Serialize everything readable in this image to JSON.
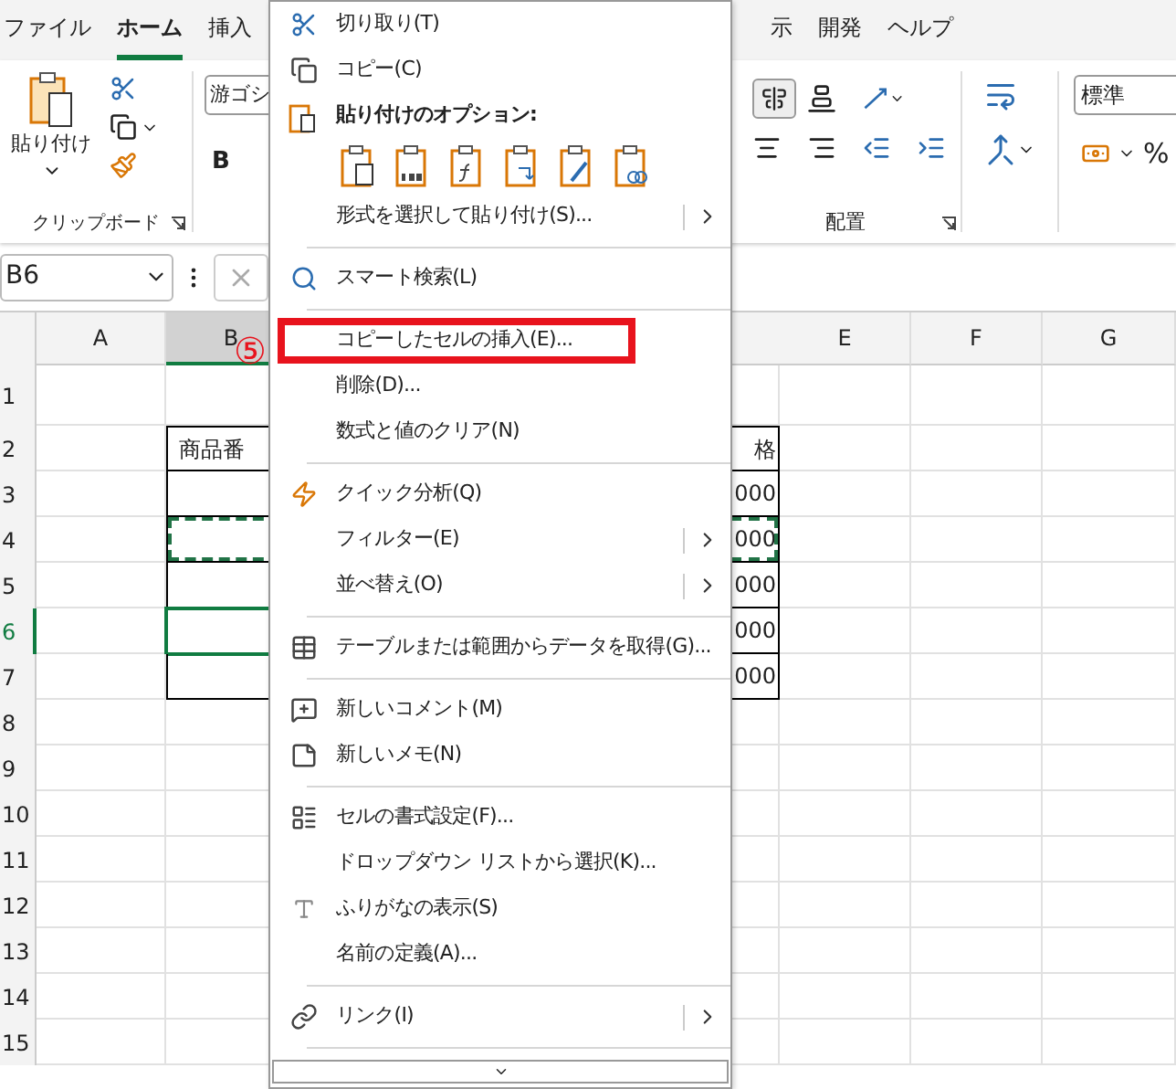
{
  "ribbon_tabs": [
    {
      "label": "ファイル",
      "selected": false
    },
    {
      "label": "ホーム",
      "selected": true
    },
    {
      "label": "挿入",
      "selected": false
    },
    {
      "label": "示",
      "selected": false
    },
    {
      "label": "開発",
      "selected": false
    },
    {
      "label": "ヘルプ",
      "selected": false
    }
  ],
  "clipboard_group": {
    "paste_label": "貼り付け",
    "group_label": "クリップボード"
  },
  "font_group": {
    "font_name": "游ゴシ",
    "bold_label": "B"
  },
  "alignment_group": {
    "group_label": "配置"
  },
  "number_group": {
    "format": "標準",
    "percent_label": "%"
  },
  "formula_bar": {
    "name_box": "B6"
  },
  "columns": [
    {
      "label": "A",
      "selected": false
    },
    {
      "label": "B",
      "selected": true
    },
    {
      "label": "E",
      "selected": false
    },
    {
      "label": "F",
      "selected": false
    },
    {
      "label": "G",
      "selected": false
    }
  ],
  "rows": [
    {
      "label": "1",
      "selected": false,
      "copied": false
    },
    {
      "label": "2",
      "selected": false,
      "copied": false,
      "column_b": "商品番",
      "column_d": "格"
    },
    {
      "label": "3",
      "selected": false,
      "copied": false,
      "column_d": "000"
    },
    {
      "label": "4",
      "selected": false,
      "copied": true,
      "column_d": "000"
    },
    {
      "label": "5",
      "selected": false,
      "copied": false,
      "column_d": "000"
    },
    {
      "label": "6",
      "selected": true,
      "copied": false,
      "column_d": "000"
    },
    {
      "label": "7",
      "selected": false,
      "copied": false,
      "column_d": "000"
    },
    {
      "label": "8",
      "selected": false,
      "copied": false
    },
    {
      "label": "9",
      "selected": false,
      "copied": false
    },
    {
      "label": "10",
      "selected": false,
      "copied": false
    },
    {
      "label": "11",
      "selected": false,
      "copied": false
    },
    {
      "label": "12",
      "selected": false,
      "copied": false
    },
    {
      "label": "13",
      "selected": false,
      "copied": false
    },
    {
      "label": "14",
      "selected": false,
      "copied": false
    },
    {
      "label": "15",
      "selected": false,
      "copied": false
    }
  ],
  "context_menu": {
    "step_marker": "⑤",
    "items": [
      {
        "kind": "item",
        "label": "切り取り(T)",
        "submenu": false,
        "highlighted": false
      },
      {
        "kind": "item",
        "label": "コピー(C)",
        "submenu": false,
        "highlighted": false
      },
      {
        "kind": "header",
        "label": "貼り付けのオプション:"
      },
      {
        "kind": "paste_icons"
      },
      {
        "kind": "item",
        "label": "形式を選択して貼り付け(S)...",
        "submenu": true,
        "highlighted": false
      },
      {
        "kind": "separator"
      },
      {
        "kind": "item",
        "label": "スマート検索(L)",
        "submenu": false,
        "highlighted": false
      },
      {
        "kind": "separator"
      },
      {
        "kind": "item",
        "label": "コピーしたセルの挿入(E)...",
        "submenu": false,
        "highlighted": true
      },
      {
        "kind": "item",
        "label": "削除(D)...",
        "submenu": false,
        "highlighted": false
      },
      {
        "kind": "item",
        "label": "数式と値のクリア(N)",
        "submenu": false,
        "highlighted": false
      },
      {
        "kind": "separator"
      },
      {
        "kind": "item",
        "label": "クイック分析(Q)",
        "submenu": false,
        "highlighted": false
      },
      {
        "kind": "item",
        "label": "フィルター(E)",
        "submenu": true,
        "highlighted": false
      },
      {
        "kind": "item",
        "label": "並べ替え(O)",
        "submenu": true,
        "highlighted": false
      },
      {
        "kind": "separator"
      },
      {
        "kind": "item",
        "label": "テーブルまたは範囲からデータを取得(G)...",
        "submenu": false,
        "highlighted": false
      },
      {
        "kind": "separator"
      },
      {
        "kind": "item",
        "label": "新しいコメント(M)",
        "submenu": false,
        "highlighted": false
      },
      {
        "kind": "item",
        "label": "新しいメモ(N)",
        "submenu": false,
        "highlighted": false
      },
      {
        "kind": "separator"
      },
      {
        "kind": "item",
        "label": "セルの書式設定(F)...",
        "submenu": false,
        "highlighted": false
      },
      {
        "kind": "item",
        "label": "ドロップダウン リストから選択(K)...",
        "submenu": false,
        "highlighted": false
      },
      {
        "kind": "item",
        "label": "ふりがなの表示(S)",
        "submenu": false,
        "highlighted": false
      },
      {
        "kind": "item",
        "label": "名前の定義(A)...",
        "submenu": false,
        "highlighted": false
      },
      {
        "kind": "separator"
      },
      {
        "kind": "item",
        "label": "リンク(I)",
        "submenu": true,
        "highlighted": false
      },
      {
        "kind": "separator"
      }
    ]
  }
}
